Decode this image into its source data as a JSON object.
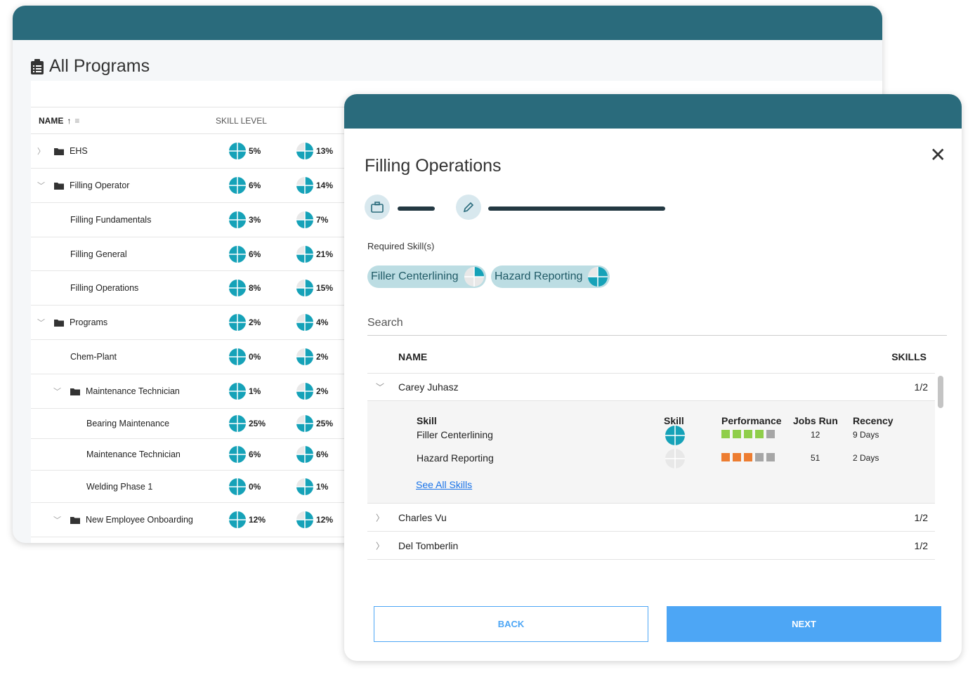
{
  "colors": {
    "header": "#2a6b7c",
    "pie": "#16a2b8",
    "pie_empty": "#e8e8e8",
    "accent": "#4da6f5",
    "perf_good": "#8fce4a",
    "perf_warn": "#ed7d31",
    "perf_none": "#a6a6a6"
  },
  "programs": {
    "title": "All Programs",
    "icon": "clipboard-icon",
    "columns": {
      "name": "NAME",
      "skill_level": "SKILL LEVEL"
    },
    "rows": [
      {
        "name": "EHS",
        "folder": true,
        "expand": "right",
        "indent": 0,
        "a": "5%",
        "b": "13%"
      },
      {
        "name": "Filling Operator",
        "folder": true,
        "expand": "down",
        "indent": 0,
        "a": "6%",
        "b": "14%"
      },
      {
        "name": "Filling Fundamentals",
        "folder": false,
        "indent": 1,
        "a": "3%",
        "b": "7%"
      },
      {
        "name": "Filling General",
        "folder": false,
        "indent": 1,
        "a": "6%",
        "b": "21%"
      },
      {
        "name": "Filling Operations",
        "folder": false,
        "indent": 1,
        "a": "8%",
        "b": "15%"
      },
      {
        "name": "Programs",
        "folder": true,
        "expand": "down",
        "indent": 0,
        "a": "2%",
        "b": "4%"
      },
      {
        "name": "Chem-Plant",
        "folder": false,
        "indent": 1,
        "a": "0%",
        "b": "2%"
      },
      {
        "name": "Maintenance Technician",
        "folder": true,
        "expand": "down",
        "indent": 1,
        "a": "1%",
        "b": "2%"
      },
      {
        "name": "Bearing Maintenance",
        "folder": false,
        "indent": 2,
        "a": "25%",
        "b": "25%"
      },
      {
        "name": "Maintenance Technician",
        "folder": false,
        "indent": 2,
        "a": "6%",
        "b": "6%"
      },
      {
        "name": "Welding Phase 1",
        "folder": false,
        "indent": 2,
        "a": "0%",
        "b": "1%"
      },
      {
        "name": "New Employee Onboarding",
        "folder": true,
        "expand": "down",
        "indent": 1,
        "a": "12%",
        "b": "12%"
      }
    ],
    "pie_a_quarters": 4,
    "pie_b_quarters": 3
  },
  "modal": {
    "title": "Filling Operations",
    "required_label": "Required Skill(s)",
    "chips": [
      {
        "label": "Filler Centerlining",
        "quarters": 1
      },
      {
        "label": "Hazard Reporting",
        "quarters": 3
      }
    ],
    "search_placeholder": "Search",
    "columns": {
      "name": "NAME",
      "skills": "SKILLS"
    },
    "people": [
      {
        "name": "Carey Juhasz",
        "skills": "1/2",
        "expanded": true
      },
      {
        "name": "Charles Vu",
        "skills": "1/2"
      },
      {
        "name": "Del Tomberlin",
        "skills": "1/2"
      }
    ],
    "detail": {
      "headers": {
        "skill": "Skill",
        "level": "Skill",
        "performance": "Performance",
        "jobs": "Jobs Run",
        "recency": "Recency"
      },
      "rows": [
        {
          "skill": "Filler Centerlining",
          "quarters": 4,
          "performance": {
            "filled": 4,
            "of": 5,
            "tone": "good"
          },
          "jobs": "12",
          "recency": "9 Days"
        },
        {
          "skill": "Hazard Reporting",
          "quarters": 0,
          "performance": {
            "filled": 3,
            "of": 5,
            "tone": "warn"
          },
          "jobs": "51",
          "recency": "2 Days"
        }
      ],
      "see_all": "See All Skills"
    },
    "back": "BACK",
    "next": "NEXT"
  }
}
